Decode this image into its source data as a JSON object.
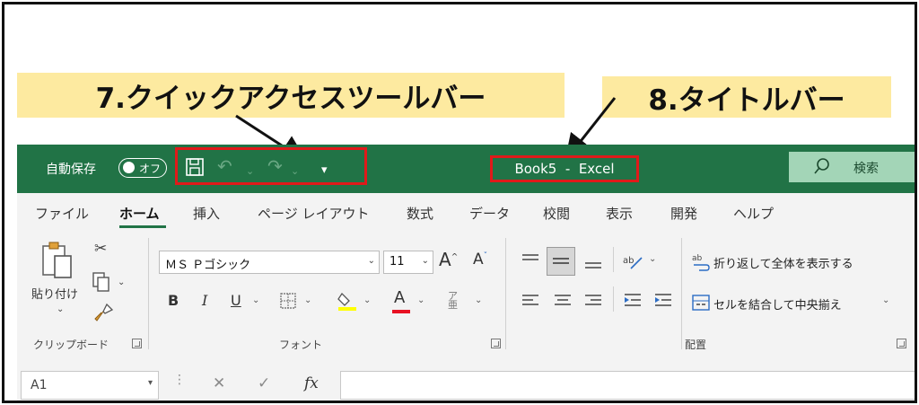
{
  "callouts": {
    "qat": "7.クイックアクセスツールバー",
    "title": "8.タイトルバー"
  },
  "titlebar": {
    "autosave_label": "自動保存",
    "autosave_state": "オフ",
    "title": "Book5  -  Excel",
    "search_label": "検索"
  },
  "tabs": [
    "ファイル",
    "ホーム",
    "挿入",
    "ページ レイアウト",
    "数式",
    "データ",
    "校閲",
    "表示",
    "開発",
    "ヘルプ"
  ],
  "active_tab": "ホーム",
  "ribbon": {
    "clipboard": {
      "paste_label": "貼り付け",
      "group_label": "クリップボード"
    },
    "font": {
      "font_name": "ＭＳ Ｐゴシック",
      "font_size": "11",
      "bold": "B",
      "italic": "I",
      "underline": "U",
      "font_color_letter": "A",
      "group_label": "フォント"
    },
    "alignment": {
      "wrap_text": "折り返して全体を表示する",
      "merge_center": "セルを結合して中央揃え",
      "group_label": "配置"
    }
  },
  "formulabar": {
    "namebox": "A1",
    "fx": "fx"
  },
  "colors": {
    "excel_green": "#217346",
    "callout_yellow": "#fdeaa0",
    "highlight_red": "#e01a1a",
    "highlight_color": "#ffff00",
    "font_color": "#e81123"
  }
}
